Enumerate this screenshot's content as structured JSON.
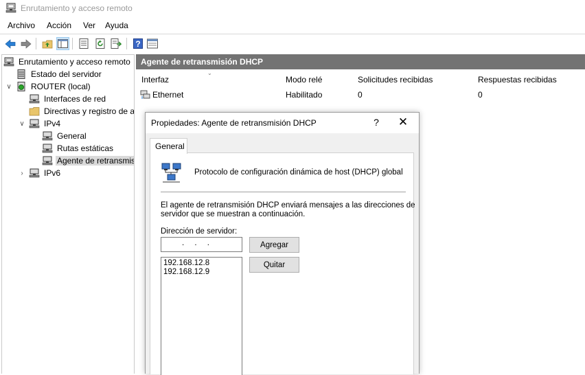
{
  "window": {
    "title": "Enrutamiento y acceso remoto"
  },
  "menubar": {
    "items": [
      "Archivo",
      "Acción",
      "Ver",
      "Ayuda"
    ]
  },
  "toolbar": {
    "icons": [
      "back-arrow-icon",
      "forward-arrow-icon",
      "up-folder-icon",
      "show-hide-tree-icon",
      "properties-icon",
      "refresh-icon",
      "export-list-icon",
      "help-icon",
      "console-icon"
    ]
  },
  "tree": {
    "root": "Enrutamiento y acceso remoto",
    "server_status": "Estado del servidor",
    "router": "ROUTER (local)",
    "interfaces": "Interfaces de red",
    "policies": "Directivas y registro de a",
    "ipv4": "IPv4",
    "general": "General",
    "static_routes": "Rutas estáticas",
    "relay": "Agente de retransmisi",
    "ipv6": "IPv6"
  },
  "right_pane": {
    "title": "Agente de retransmisión DHCP",
    "columns": [
      "Interfaz",
      "Modo relé",
      "Solicitudes recibidas",
      "Respuestas recibidas"
    ],
    "rows": [
      {
        "interface": "Ethernet",
        "mode": "Habilitado",
        "requests": "0",
        "responses": "0"
      }
    ]
  },
  "dialog": {
    "title": "Propiedades: Agente de retransmisión DHCP",
    "help_label": "?",
    "close_label": "✕",
    "tab": "General",
    "heading": "Protocolo de configuración dinámica de host (DHCP) global",
    "desc_line1": "El agente de retransmisión DHCP enviará mensajes a las direcciones de",
    "desc_line2": "servidor que se muestran a continuación.",
    "server_label": "Dirección de servidor:",
    "ip_input_value": ".   .   .",
    "add_button": "Agregar",
    "remove_button": "Quitar",
    "servers": [
      "192.168.12.8",
      "192.168.12.9"
    ]
  }
}
